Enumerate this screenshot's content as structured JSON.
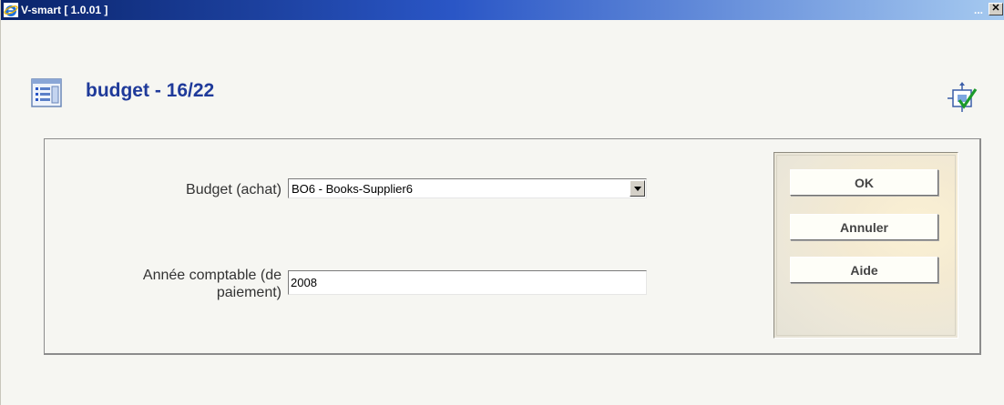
{
  "window": {
    "title": "V-smart [ 1.0.01 ]",
    "minimize_label": "...",
    "close_label": "✕"
  },
  "header": {
    "title": "budget - 16/22"
  },
  "form": {
    "budget": {
      "label": "Budget (achat)",
      "value": "BO6 - Books-Supplier6"
    },
    "year": {
      "label_line1": "Année comptable (de",
      "label_line2": "paiement)",
      "value": "2008"
    }
  },
  "buttons": {
    "ok": "OK",
    "cancel": "Annuler",
    "help": "Aide"
  },
  "colors": {
    "title_text": "#1f3a9a",
    "titlebar_start": "#0a246a",
    "titlebar_end": "#a6caf0"
  }
}
